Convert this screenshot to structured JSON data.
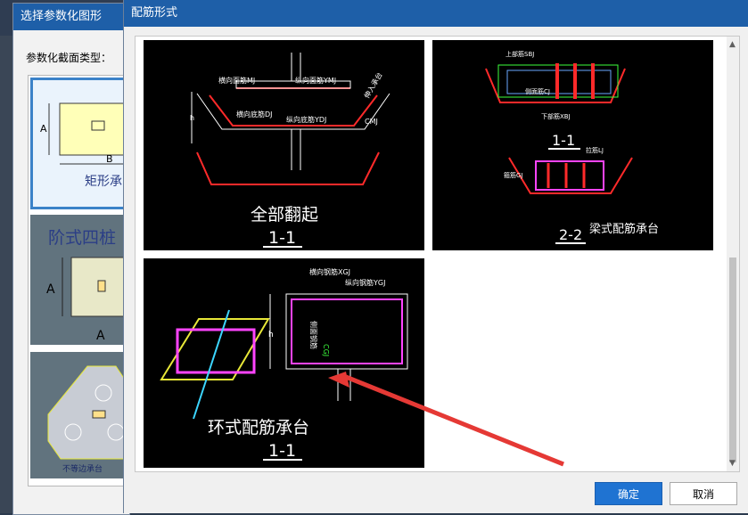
{
  "bg_dialog": {
    "title": "选择参数化图形",
    "section_label": "参数化截面类型：",
    "thumbs": [
      {
        "caption": "矩形承台"
      },
      {
        "caption": "阶式四桩"
      },
      {
        "caption": "不等边承台"
      }
    ],
    "thumb1_dims": {
      "a": "A",
      "b": "B"
    },
    "thumb2_dims": {
      "a": "A"
    }
  },
  "dialog": {
    "title": "配筋形式",
    "ok_label": "确定",
    "cancel_label": "取消"
  },
  "options": [
    {
      "caption": "全部翻起",
      "section": "1-1",
      "labels": {
        "top_bar": "横向面筋MJ",
        "top_bar2": "纵向面筋YMJ",
        "bot_bar": "横向底筋DJ",
        "bot_bar2": "纵向底筋YDJ",
        "side": "CMJ",
        "pile": "伸入承台"
      }
    },
    {
      "caption": "梁式配筋承台",
      "section_a": "1-1",
      "section_b": "2-2",
      "labels": {
        "top": "上部筋SBJ",
        "bot": "下部筋XBJ",
        "side": "侧面筋CJ",
        "tie": "拉筋LJ",
        "stir": "箍筋GJ"
      }
    },
    {
      "caption": "环式配筋承台",
      "section": "1-1",
      "labels": {
        "hbar": "横向钢筋XGJ",
        "vbar": "纵向钢筋YGJ",
        "side": "侧面钢筋",
        "side_code": "CGJ",
        "h": "h"
      }
    }
  ],
  "colors": {
    "title_bar": "#1e5fa8",
    "ok_button": "#1f73d2",
    "arrow": "#e53935"
  }
}
